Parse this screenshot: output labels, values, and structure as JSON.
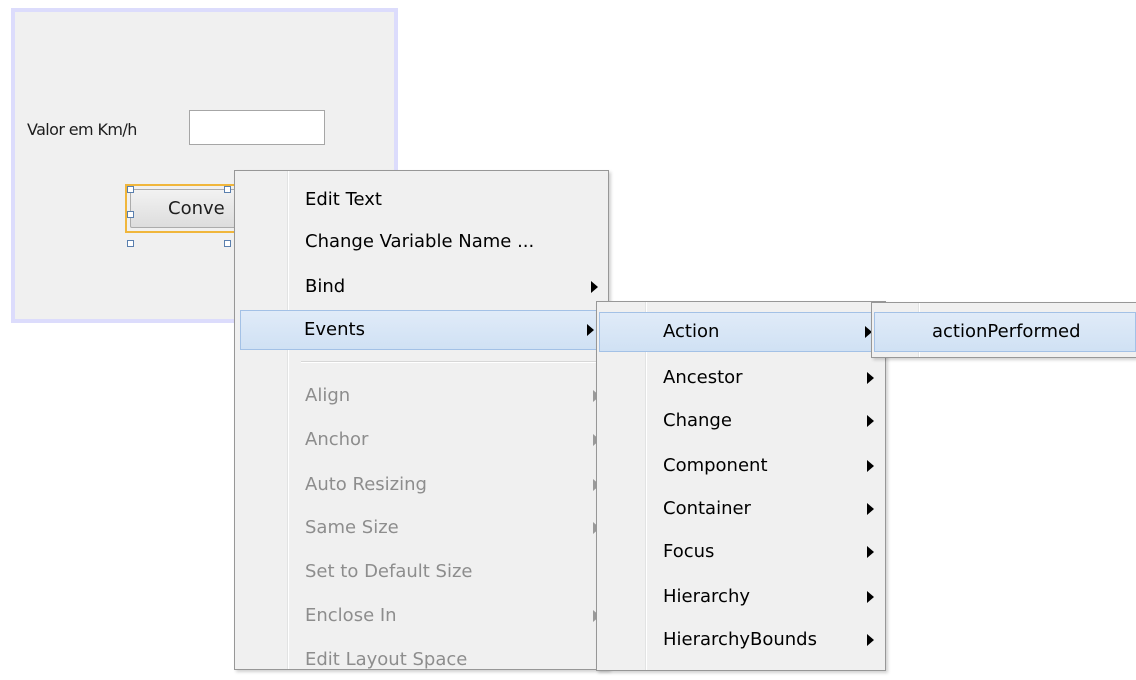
{
  "form": {
    "field_label": "Valor em Km/h",
    "input_value": "",
    "button_label": "Conve"
  },
  "context_menu": {
    "items": [
      {
        "label": "Edit Text",
        "enabled": true,
        "submenu": false
      },
      {
        "label": "Change Variable Name ...",
        "enabled": true,
        "submenu": false
      },
      {
        "label": "Bind",
        "enabled": true,
        "submenu": true
      },
      {
        "label": "Events",
        "enabled": true,
        "submenu": true,
        "highlighted": true
      },
      {
        "label": "Align",
        "enabled": false,
        "submenu": true
      },
      {
        "label": "Anchor",
        "enabled": false,
        "submenu": true
      },
      {
        "label": "Auto Resizing",
        "enabled": false,
        "submenu": true
      },
      {
        "label": "Same Size",
        "enabled": false,
        "submenu": true
      },
      {
        "label": "Set to Default Size",
        "enabled": false,
        "submenu": false
      },
      {
        "label": "Enclose In",
        "enabled": false,
        "submenu": true
      },
      {
        "label": "Edit Layout Space",
        "enabled": false,
        "submenu": false
      }
    ]
  },
  "events_submenu": {
    "items": [
      {
        "label": "Action",
        "highlighted": true
      },
      {
        "label": "Ancestor"
      },
      {
        "label": "Change"
      },
      {
        "label": "Component"
      },
      {
        "label": "Container"
      },
      {
        "label": "Focus"
      },
      {
        "label": "Hierarchy"
      },
      {
        "label": "HierarchyBounds"
      }
    ]
  },
  "action_submenu": {
    "items": [
      {
        "label": "actionPerformed",
        "highlighted": true
      }
    ]
  },
  "colors": {
    "menu_bg": "#f0f0f0",
    "highlight_bg": "#d5e5f6",
    "highlight_border": "#a3c1e6",
    "disabled_text": "#8d8d8d",
    "selection_outline": "#f0b63c",
    "panel_border": "#dcdcfc"
  }
}
